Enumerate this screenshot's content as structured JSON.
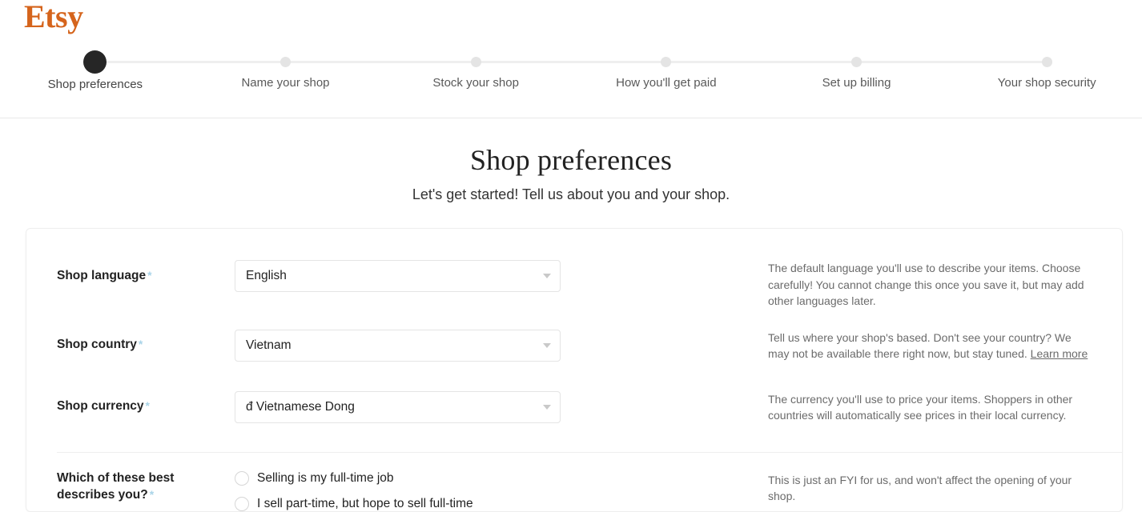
{
  "brand": {
    "logo_text": "Etsy",
    "logo_color": "#d5641c"
  },
  "stepper": {
    "steps": [
      {
        "label": "Shop preferences",
        "state": "active"
      },
      {
        "label": "Name your shop",
        "state": "upcoming"
      },
      {
        "label": "Stock your shop",
        "state": "upcoming"
      },
      {
        "label": "How you'll get paid",
        "state": "upcoming"
      },
      {
        "label": "Set up billing",
        "state": "upcoming"
      },
      {
        "label": "Your shop security",
        "state": "upcoming"
      }
    ],
    "active_dot_color": "#262626",
    "inactive_dot_color": "#e4e4e4"
  },
  "page": {
    "title": "Shop preferences",
    "subtitle": "Let's get started! Tell us about you and your shop."
  },
  "form": {
    "required_marker": "*",
    "language": {
      "label": "Shop language",
      "value": "English",
      "help": "The default language you'll use to describe your items. Choose carefully! You cannot change this once you save it, but may add other languages later."
    },
    "country": {
      "label": "Shop country",
      "value": "Vietnam",
      "help_before_link": "Tell us where your shop's based. Don't see your country? We may not be available there right now, but stay tuned. ",
      "help_link": "Learn more"
    },
    "currency": {
      "label": "Shop currency",
      "value": "đ Vietnamese Dong",
      "help": "The currency you'll use to price your items. Shoppers in other countries will automatically see prices in their local currency."
    },
    "seller_type": {
      "label": "Which of these best describes you?",
      "options": [
        {
          "label": "Selling is my full-time job",
          "selected": false
        },
        {
          "label": "I sell part-time, but hope to sell full-time",
          "selected": false
        }
      ],
      "help": "This is just an FYI for us, and won't affect the opening of your shop."
    }
  }
}
